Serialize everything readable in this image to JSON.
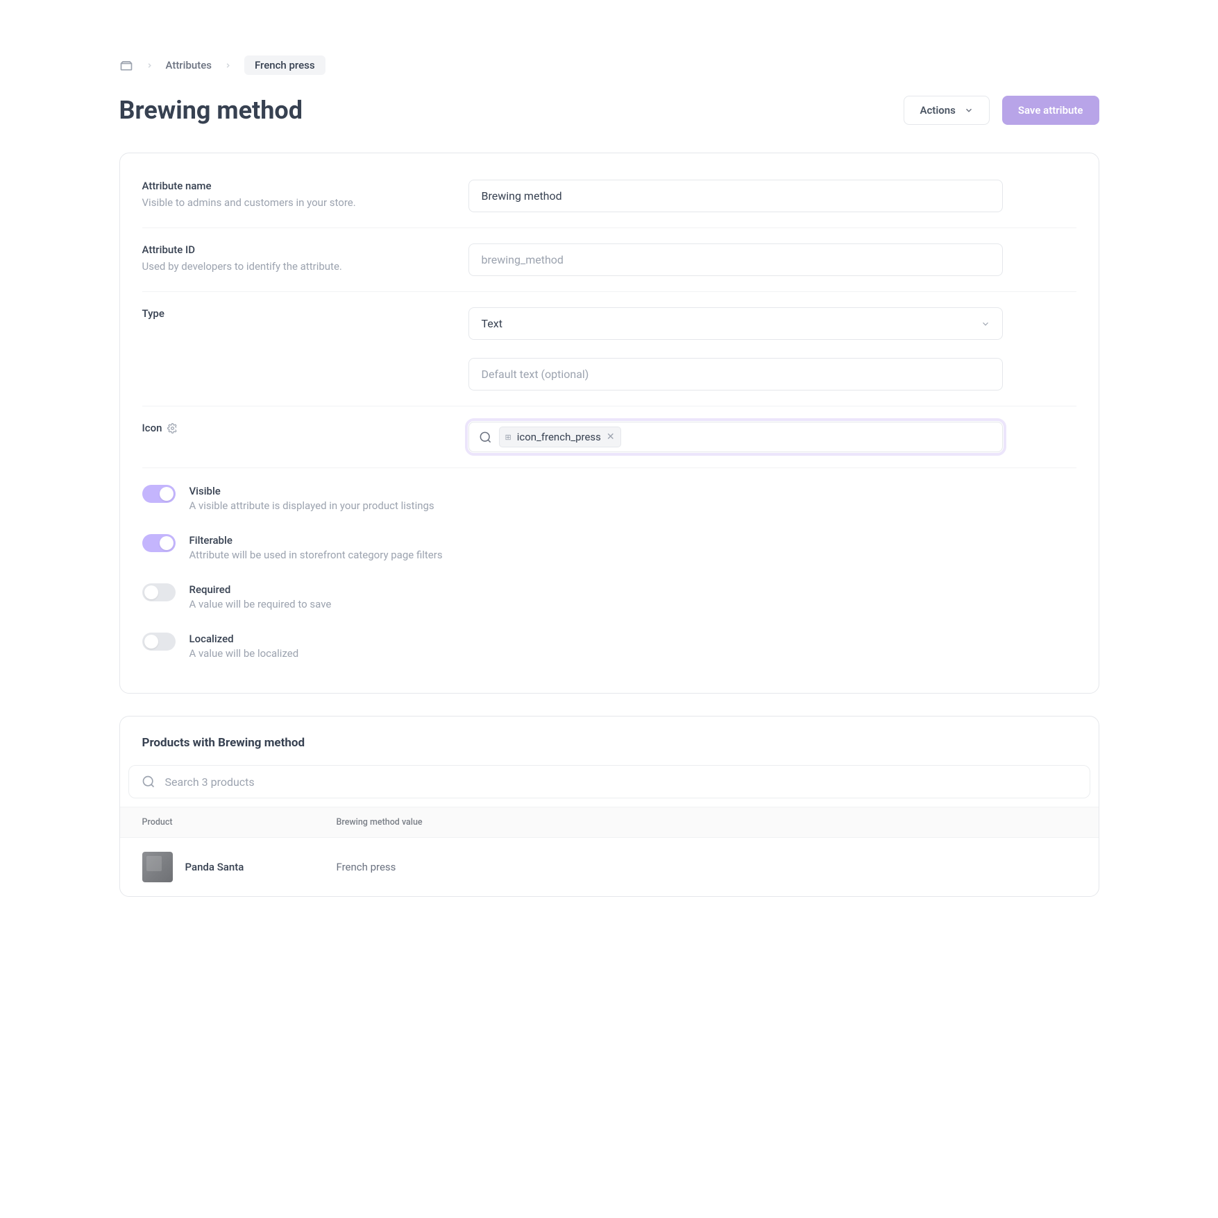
{
  "breadcrumb": {
    "link": "Attributes",
    "current": "French press"
  },
  "header": {
    "title": "Brewing method",
    "actions_label": "Actions",
    "save_label": "Save attribute"
  },
  "fields": {
    "name": {
      "label": "Attribute name",
      "desc": "Visible to admins and customers in your store.",
      "value": "Brewing method"
    },
    "id": {
      "label": "Attribute ID",
      "desc": "Used by developers to identify the attribute.",
      "placeholder": "brewing_method"
    },
    "type": {
      "label": "Type",
      "value": "Text",
      "default_placeholder": "Default text (optional)"
    },
    "icon": {
      "label": "Icon",
      "token": "icon_french_press"
    }
  },
  "toggles": [
    {
      "key": "visible",
      "label": "Visible",
      "desc": "A visible attribute is displayed in your product listings",
      "on": true
    },
    {
      "key": "filterable",
      "label": "Filterable",
      "desc": "Attribute will be used in storefront category page filters",
      "on": true
    },
    {
      "key": "required",
      "label": "Required",
      "desc": "A value will be required to save",
      "on": false
    },
    {
      "key": "localized",
      "label": "Localized",
      "desc": "A value will be localized",
      "on": false
    }
  ],
  "products": {
    "title": "Products with Brewing method",
    "search_placeholder": "Search 3 products",
    "columns": {
      "product": "Product",
      "value": "Brewing method value"
    },
    "rows": [
      {
        "name": "Panda Santa",
        "value": "French press"
      }
    ]
  }
}
